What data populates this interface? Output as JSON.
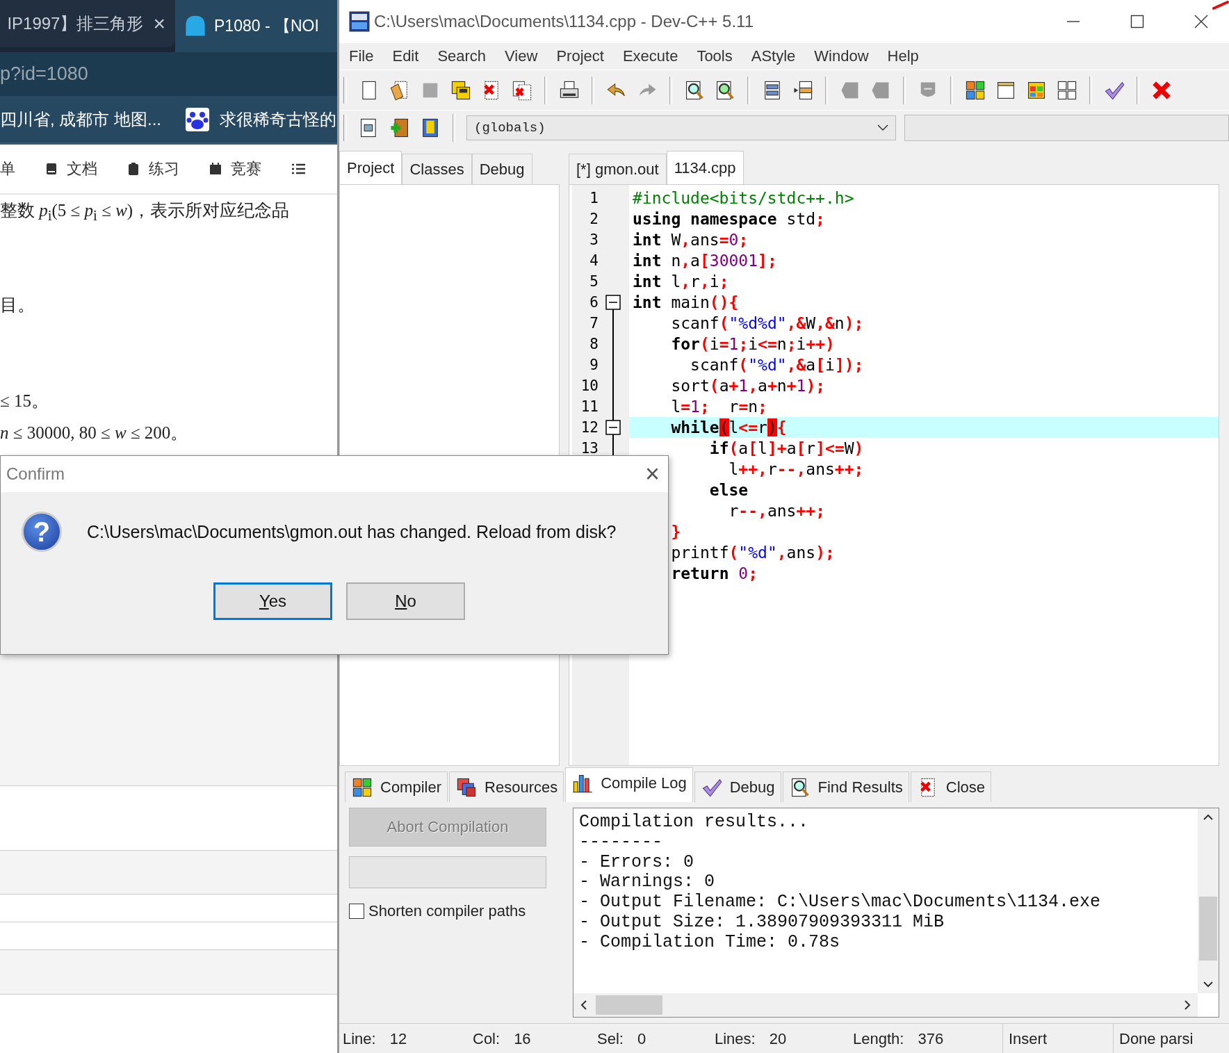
{
  "browser": {
    "tabs": [
      {
        "title": "IP1997】排三角形",
        "close": "×",
        "selected": false
      },
      {
        "title": "P1080 - 【NOI",
        "selected": true
      }
    ],
    "address": "p?id=1080",
    "bookmarks": [
      {
        "label": "四川省, 成都市 地图...",
        "kind": "plain"
      },
      {
        "label": "求很稀奇古怪的",
        "kind": "site"
      }
    ],
    "nav": [
      {
        "label": "单",
        "kind": "plain"
      },
      {
        "label": "文档",
        "kind": "doc"
      },
      {
        "label": "练习",
        "kind": "clipboard"
      },
      {
        "label": "竞赛",
        "kind": "calendar"
      },
      {
        "kind": "list"
      }
    ],
    "content": [
      "整数 *p*$_{i}$(5 ≤ *p*$_{i}$ ≤ *w*)，表示所对应纪念品",
      "目。",
      "≤ 15。",
      "*n* ≤ 30000, 80 ≤ *w* ≤ 200。"
    ]
  },
  "ide": {
    "title": "C:\\Users\\mac\\Documents\\1134.cpp - Dev-C++ 5.11",
    "menu": [
      "File",
      "Edit",
      "Search",
      "View",
      "Project",
      "Execute",
      "Tools",
      "AStyle",
      "Window",
      "Help"
    ],
    "class_combo": "(globals)",
    "side_tabs": [
      {
        "label": "Project",
        "selected": true
      },
      {
        "label": "Classes",
        "selected": false
      },
      {
        "label": "Debug",
        "selected": false
      }
    ],
    "editor_tabs": [
      {
        "label": "[*] gmon.out",
        "selected": false
      },
      {
        "label": "1134.cpp",
        "selected": true
      }
    ],
    "code_lines": [
      {
        "number": "1",
        "fold": false,
        "current": false,
        "segments": [
          {
            "text": "#include<bits/stdc++.h>",
            "kind": "directive"
          }
        ]
      },
      {
        "number": "2",
        "fold": false,
        "current": false,
        "segments": [
          {
            "text": "using namespace",
            "kind": "keyword"
          },
          {
            "text": " std",
            "kind": "ident"
          },
          {
            "text": ";",
            "kind": "symbol"
          }
        ]
      },
      {
        "number": "3",
        "fold": false,
        "current": false,
        "segments": [
          {
            "text": "int",
            "kind": "keyword"
          },
          {
            "text": " W",
            "kind": "ident"
          },
          {
            "text": ",",
            "kind": "symbol"
          },
          {
            "text": "ans",
            "kind": "ident"
          },
          {
            "text": "=",
            "kind": "symbol"
          },
          {
            "text": "0",
            "kind": "number"
          },
          {
            "text": ";",
            "kind": "symbol"
          }
        ]
      },
      {
        "number": "4",
        "fold": false,
        "current": false,
        "segments": [
          {
            "text": "int",
            "kind": "keyword"
          },
          {
            "text": " n",
            "kind": "ident"
          },
          {
            "text": ",",
            "kind": "symbol"
          },
          {
            "text": "a",
            "kind": "ident"
          },
          {
            "text": "[",
            "kind": "symbol"
          },
          {
            "text": "30001",
            "kind": "number"
          },
          {
            "text": "];",
            "kind": "symbol"
          }
        ]
      },
      {
        "number": "5",
        "fold": false,
        "current": false,
        "segments": [
          {
            "text": "int",
            "kind": "keyword"
          },
          {
            "text": " l",
            "kind": "ident"
          },
          {
            "text": ",",
            "kind": "symbol"
          },
          {
            "text": "r",
            "kind": "ident"
          },
          {
            "text": ",",
            "kind": "symbol"
          },
          {
            "text": "i",
            "kind": "ident"
          },
          {
            "text": ";",
            "kind": "symbol"
          }
        ]
      },
      {
        "number": "6",
        "fold": true,
        "current": false,
        "segments": [
          {
            "text": "int",
            "kind": "keyword"
          },
          {
            "text": " main",
            "kind": "ident"
          },
          {
            "text": "(){",
            "kind": "symbol"
          }
        ]
      },
      {
        "number": "7",
        "fold": false,
        "current": false,
        "segments": [
          {
            "text": "    scanf",
            "kind": "ident"
          },
          {
            "text": "(",
            "kind": "symbol"
          },
          {
            "text": "\"%d%d\"",
            "kind": "string"
          },
          {
            "text": ",&",
            "kind": "symbol"
          },
          {
            "text": "W",
            "kind": "ident"
          },
          {
            "text": ",&",
            "kind": "symbol"
          },
          {
            "text": "n",
            "kind": "ident"
          },
          {
            "text": ");",
            "kind": "symbol"
          }
        ]
      },
      {
        "number": "8",
        "fold": false,
        "current": false,
        "segments": [
          {
            "text": "    for",
            "kind": "keyword"
          },
          {
            "text": "(",
            "kind": "symbol"
          },
          {
            "text": "i",
            "kind": "ident"
          },
          {
            "text": "=",
            "kind": "symbol"
          },
          {
            "text": "1",
            "kind": "number"
          },
          {
            "text": ";",
            "kind": "symbol"
          },
          {
            "text": "i",
            "kind": "ident"
          },
          {
            "text": "<=",
            "kind": "symbol"
          },
          {
            "text": "n",
            "kind": "ident"
          },
          {
            "text": ";",
            "kind": "symbol"
          },
          {
            "text": "i",
            "kind": "ident"
          },
          {
            "text": "++)",
            "kind": "symbol"
          }
        ]
      },
      {
        "number": "9",
        "fold": false,
        "current": false,
        "segments": [
          {
            "text": "      scanf",
            "kind": "ident"
          },
          {
            "text": "(",
            "kind": "symbol"
          },
          {
            "text": "\"%d\"",
            "kind": "string"
          },
          {
            "text": ",&",
            "kind": "symbol"
          },
          {
            "text": "a",
            "kind": "ident"
          },
          {
            "text": "[",
            "kind": "symbol"
          },
          {
            "text": "i",
            "kind": "ident"
          },
          {
            "text": "]);",
            "kind": "symbol"
          }
        ]
      },
      {
        "number": "10",
        "fold": false,
        "current": false,
        "segments": [
          {
            "text": "    sort",
            "kind": "ident"
          },
          {
            "text": "(",
            "kind": "symbol"
          },
          {
            "text": "a",
            "kind": "ident"
          },
          {
            "text": "+",
            "kind": "symbol"
          },
          {
            "text": "1",
            "kind": "number"
          },
          {
            "text": ",",
            "kind": "symbol"
          },
          {
            "text": "a",
            "kind": "ident"
          },
          {
            "text": "+",
            "kind": "symbol"
          },
          {
            "text": "n",
            "kind": "ident"
          },
          {
            "text": "+",
            "kind": "symbol"
          },
          {
            "text": "1",
            "kind": "number"
          },
          {
            "text": ");",
            "kind": "symbol"
          }
        ]
      },
      {
        "number": "11",
        "fold": false,
        "current": false,
        "segments": [
          {
            "text": "    l",
            "kind": "ident"
          },
          {
            "text": "=",
            "kind": "symbol"
          },
          {
            "text": "1",
            "kind": "number"
          },
          {
            "text": ";",
            "kind": "symbol"
          },
          {
            "text": "  r",
            "kind": "ident"
          },
          {
            "text": "=",
            "kind": "symbol"
          },
          {
            "text": "n",
            "kind": "ident"
          },
          {
            "text": ";",
            "kind": "symbol"
          }
        ]
      },
      {
        "number": "12",
        "fold": true,
        "current": true,
        "segments": [
          {
            "text": "    while",
            "kind": "keyword"
          },
          {
            "text": "(",
            "kind": "match"
          },
          {
            "text": "l",
            "kind": "ident"
          },
          {
            "text": "<=",
            "kind": "symbol"
          },
          {
            "text": "r",
            "kind": "ident"
          },
          {
            "text": ")",
            "kind": "match"
          },
          {
            "text": "{",
            "kind": "symbol"
          }
        ]
      },
      {
        "number": "13",
        "fold": false,
        "current": false,
        "segments": [
          {
            "text": "        if",
            "kind": "keyword"
          },
          {
            "text": "(",
            "kind": "symbol"
          },
          {
            "text": "a",
            "kind": "ident"
          },
          {
            "text": "[",
            "kind": "symbol"
          },
          {
            "text": "l",
            "kind": "ident"
          },
          {
            "text": "]+",
            "kind": "symbol"
          },
          {
            "text": "a",
            "kind": "ident"
          },
          {
            "text": "[",
            "kind": "symbol"
          },
          {
            "text": "r",
            "kind": "ident"
          },
          {
            "text": "]<=",
            "kind": "symbol"
          },
          {
            "text": "W",
            "kind": "ident"
          },
          {
            "text": ")",
            "kind": "symbol"
          }
        ]
      },
      {
        "current": false,
        "segments": [
          {
            "text": "          l",
            "kind": "ident"
          },
          {
            "text": "++,",
            "kind": "symbol"
          },
          {
            "text": "r",
            "kind": "ident"
          },
          {
            "text": "--,",
            "kind": "symbol"
          },
          {
            "text": "ans",
            "kind": "ident"
          },
          {
            "text": "++;",
            "kind": "symbol"
          }
        ]
      },
      {
        "current": false,
        "segments": [
          {
            "text": "        else",
            "kind": "keyword"
          }
        ]
      },
      {
        "current": false,
        "segments": [
          {
            "text": "          r",
            "kind": "ident"
          },
          {
            "text": "--,",
            "kind": "symbol"
          },
          {
            "text": "ans",
            "kind": "ident"
          },
          {
            "text": "++;",
            "kind": "symbol"
          }
        ]
      },
      {
        "current": false,
        "segments": [
          {
            "text": "    }",
            "kind": "symbol"
          }
        ]
      },
      {
        "current": false,
        "segments": [
          {
            "text": "    printf",
            "kind": "ident"
          },
          {
            "text": "(",
            "kind": "symbol"
          },
          {
            "text": "\"%d\"",
            "kind": "string"
          },
          {
            "text": ",",
            "kind": "symbol"
          },
          {
            "text": "ans",
            "kind": "ident"
          },
          {
            "text": ");",
            "kind": "symbol"
          }
        ]
      },
      {
        "current": false,
        "segments": [
          {
            "text": "    return ",
            "kind": "keyword"
          },
          {
            "text": "0",
            "kind": "number"
          },
          {
            "text": ";",
            "kind": "symbol"
          }
        ]
      }
    ],
    "bottom_tabs": [
      {
        "label": "Compiler",
        "kind": "compiler",
        "selected": false
      },
      {
        "label": "Resources",
        "kind": "resources",
        "selected": false
      },
      {
        "label": "Compile Log",
        "kind": "log",
        "selected": true
      },
      {
        "label": "Debug",
        "kind": "debug",
        "selected": false
      },
      {
        "label": "Find Results",
        "kind": "find",
        "selected": false
      },
      {
        "label": "Close",
        "kind": "close",
        "selected": false
      }
    ],
    "abort_button": {
      "label": "Abort Compilation",
      "disabled": true
    },
    "compile_progress": {
      "level": 0
    },
    "shorten_paths": {
      "label": "Shorten compiler paths",
      "checked": false
    },
    "log": [
      "Compilation results...",
      "--------",
      "- Errors: 0",
      "- Warnings: 0",
      "- Output Filename: C:\\Users\\mac\\Documents\\1134.exe",
      "- Output Size: 1.38907909393311 MiB",
      "- Compilation Time: 0.78s"
    ],
    "status": [
      {
        "label": "Line:",
        "value": "12"
      },
      {
        "label": "Col:",
        "value": "16"
      },
      {
        "label": "Sel:",
        "value": "0"
      },
      {
        "label": "Lines:",
        "value": "20"
      },
      {
        "label": "Length:",
        "value": "376"
      },
      {
        "value": "Insert"
      },
      {
        "value": "Done parsi"
      }
    ]
  },
  "dialog": {
    "title": "Confirm",
    "close": "×",
    "icon": "?",
    "message": "C:\\Users\\mac\\Documents\\gmon.out has changed. Reload from disk?",
    "buttons": [
      {
        "label": "Yes",
        "focused": true
      },
      {
        "label": "No",
        "focused": false
      }
    ]
  }
}
